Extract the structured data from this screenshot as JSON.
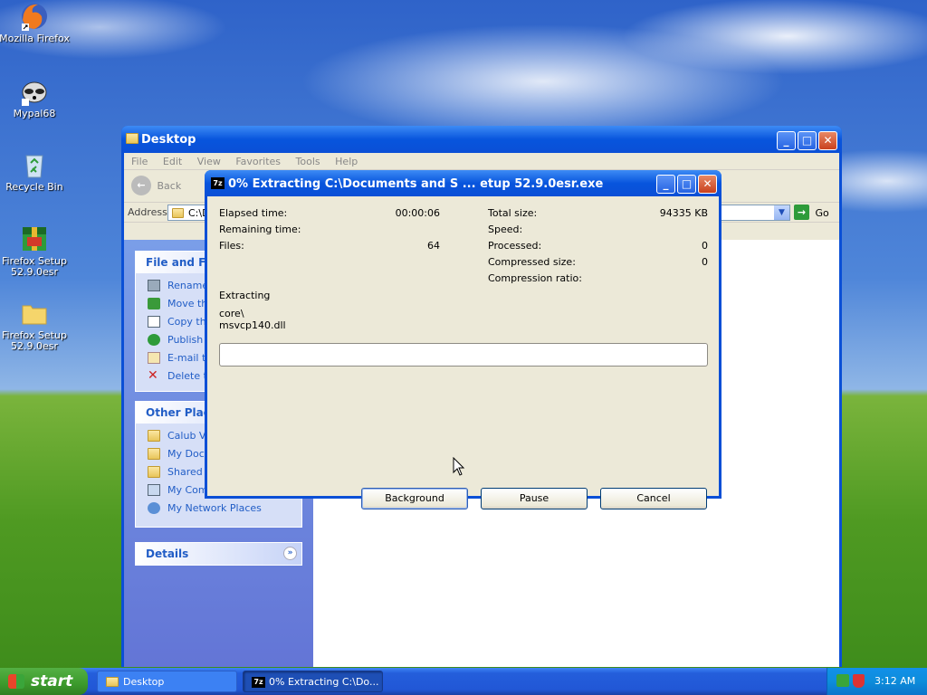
{
  "desktop": {
    "icons": [
      {
        "label": "Mozilla Firefox"
      },
      {
        "label": "Mypal68"
      },
      {
        "label": "Recycle Bin"
      },
      {
        "label": "Firefox Setup 52.9.0esr"
      },
      {
        "label": "Firefox Setup 52.9.0esr"
      }
    ]
  },
  "explorer": {
    "title": "Desktop",
    "menu": [
      "File",
      "Edit",
      "View",
      "Favorites",
      "Tools",
      "Help"
    ],
    "back_label": "Back",
    "address_label": "Address",
    "address_value": "C:\\D",
    "go_label": "Go",
    "file_tasks": {
      "header": "File and Fold",
      "items": [
        "Rename",
        "Move thi",
        "Copy thi",
        "Publish t",
        "E-mail th",
        "Delete th"
      ]
    },
    "other_places": {
      "header": "Other Place",
      "items": [
        "Calub Vie",
        "My Docu",
        "Shared D",
        "My Comp",
        "My Network Places"
      ]
    },
    "details": {
      "header": "Details"
    }
  },
  "dialog": {
    "title": "0% Extracting C:\\Documents and S ... etup 52.9.0esr.exe",
    "elapsed_label": "Elapsed time:",
    "elapsed_value": "00:00:06",
    "remaining_label": "Remaining time:",
    "remaining_value": "",
    "files_label": "Files:",
    "files_value": "64",
    "total_size_label": "Total size:",
    "total_size_value": "94335 KB",
    "speed_label": "Speed:",
    "speed_value": "",
    "processed_label": "Processed:",
    "processed_value": "0",
    "compressed_label": "Compressed size:",
    "compressed_value": "0",
    "ratio_label": "Compression ratio:",
    "ratio_value": "",
    "status": "Extracting",
    "current_path": "core\\",
    "current_file": "msvcp140.dll",
    "progress_percent": 0,
    "buttons": {
      "background": "Background",
      "pause": "Pause",
      "cancel": "Cancel"
    }
  },
  "taskbar": {
    "start_label": "start",
    "tasks": [
      {
        "label": "Desktop"
      },
      {
        "label": "0% Extracting C:\\Do..."
      }
    ],
    "clock": "3:12 AM"
  }
}
